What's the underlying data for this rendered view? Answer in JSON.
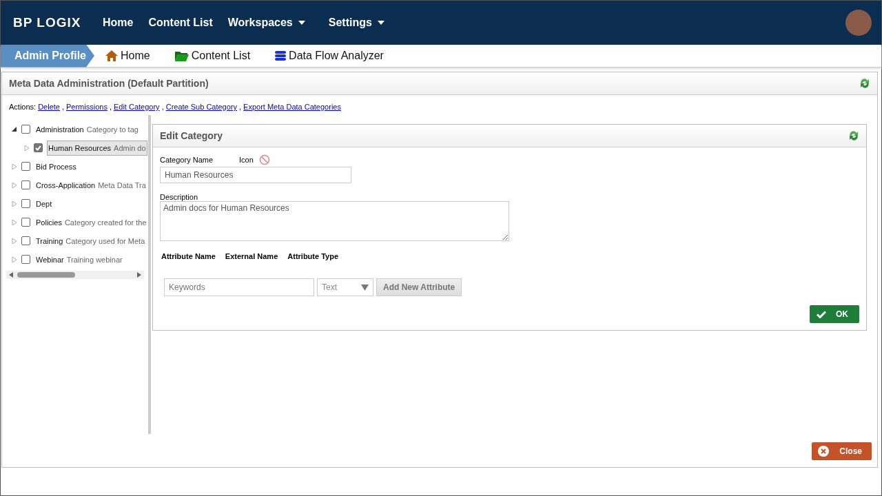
{
  "topnav": {
    "logo": "BP LOGIX",
    "items": [
      {
        "label": "Home",
        "dropdown": false
      },
      {
        "label": "Content List",
        "dropdown": false
      },
      {
        "label": "Workspaces",
        "dropdown": true
      },
      {
        "label": "Settings",
        "dropdown": true
      }
    ]
  },
  "breadcrumb": {
    "profile": "Admin Profile",
    "links": [
      {
        "label": "Home",
        "kind": "home"
      },
      {
        "label": "Content List",
        "kind": "folder"
      },
      {
        "label": "Data Flow Analyzer",
        "kind": "database"
      }
    ]
  },
  "panel": {
    "title": "Meta Data Administration (Default Partition)"
  },
  "actions": {
    "label": "Actions:",
    "separator": ",",
    "links": [
      "Delete",
      "Permissions",
      "Edit Category",
      "Create Sub Category",
      "Export Meta Data Categories"
    ]
  },
  "tree": [
    {
      "name": "Administration",
      "description": "Category to tag",
      "expanded": true,
      "checked": false,
      "selected": false,
      "children": [
        {
          "name": "Human Resources",
          "description": "Admin do",
          "expanded": false,
          "checked": true,
          "selected": true
        }
      ]
    },
    {
      "name": "Bid Process",
      "expanded": false,
      "checked": false,
      "selected": false
    },
    {
      "name": "Cross-Application",
      "description": "Meta Data Tra",
      "expanded": false,
      "checked": false,
      "selected": false
    },
    {
      "name": "Dept",
      "expanded": false,
      "checked": false,
      "selected": false
    },
    {
      "name": "Policies",
      "description": "Category created for the",
      "expanded": false,
      "checked": false,
      "selected": false
    },
    {
      "name": "Training",
      "description": "Category used for Meta",
      "expanded": false,
      "checked": false,
      "selected": false
    },
    {
      "name": "Webinar",
      "description": "Training webinar",
      "expanded": false,
      "checked": false,
      "selected": false
    }
  ],
  "edit": {
    "title": "Edit Category",
    "name_label": "Category Name",
    "icon_label": "Icon",
    "name_value": "Human Resources",
    "description_label": "Description",
    "description_value": "Admin docs for Human Resources",
    "columns": [
      "Attribute Name",
      "External Name",
      "Attribute Type"
    ],
    "attribute_placeholder": "Keywords",
    "type_value": "Text",
    "add_button": "Add New Attribute",
    "ok_button": "OK"
  },
  "close_button": "Close"
}
